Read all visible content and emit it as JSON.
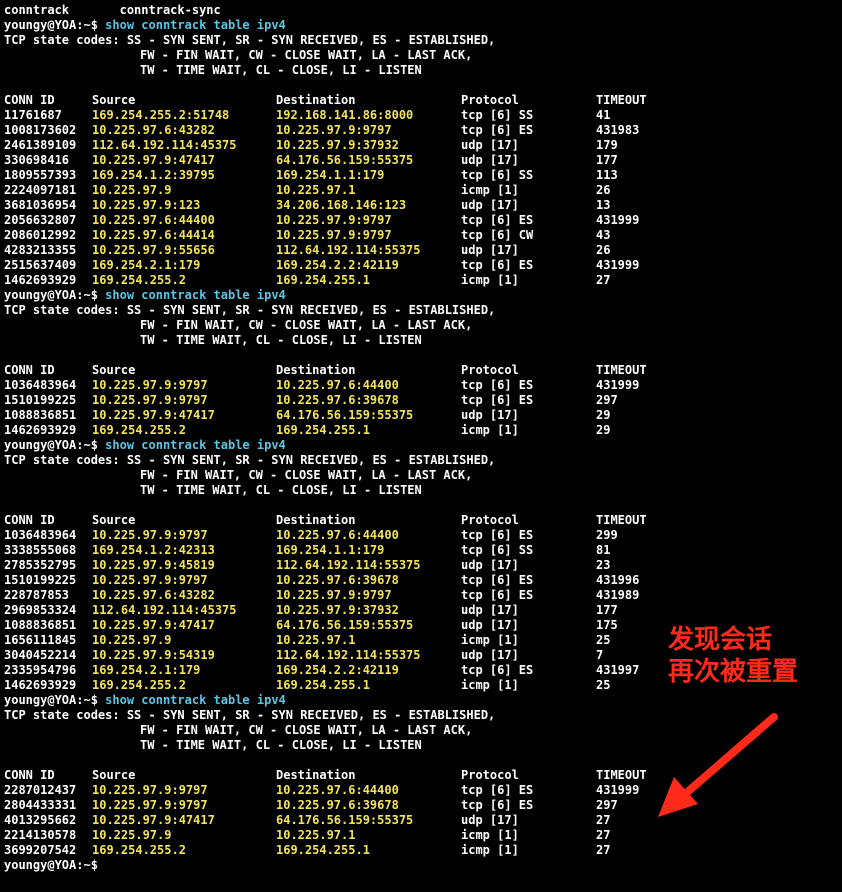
{
  "header_line": "conntrack       conntrack-sync",
  "prompt": "youngy@YOA:~$",
  "command": "show conntrack table ipv4",
  "legend": [
    "TCP state codes: SS - SYN SENT, SR - SYN RECEIVED, ES - ESTABLISHED,",
    "FW - FIN WAIT, CW - CLOSE WAIT, LA - LAST ACK,",
    "TW - TIME WAIT, CL - CLOSE, LI - LISTEN"
  ],
  "columns": [
    "CONN ID",
    "Source",
    "Destination",
    "Protocol",
    "TIMEOUT"
  ],
  "tables": [
    {
      "rows": [
        [
          "11761687",
          "169.254.255.2:51748",
          "192.168.141.86:8000",
          "tcp [6] SS",
          "41"
        ],
        [
          "1008173602",
          "10.225.97.6:43282",
          "10.225.97.9:9797",
          "tcp [6] ES",
          "431983"
        ],
        [
          "2461389109",
          "112.64.192.114:45375",
          "10.225.97.9:37932",
          "udp [17]",
          "179"
        ],
        [
          "330698416",
          "10.225.97.9:47417",
          "64.176.56.159:55375",
          "udp [17]",
          "177"
        ],
        [
          "1809557393",
          "169.254.1.2:39795",
          "169.254.1.1:179",
          "tcp [6] SS",
          "113"
        ],
        [
          "2224097181",
          "10.225.97.9",
          "10.225.97.1",
          "icmp [1]",
          "26"
        ],
        [
          "3681036954",
          "10.225.97.9:123",
          "34.206.168.146:123",
          "udp [17]",
          "13"
        ],
        [
          "2056632807",
          "10.225.97.6:44400",
          "10.225.97.9:9797",
          "tcp [6] ES",
          "431999"
        ],
        [
          "2086012992",
          "10.225.97.6:44414",
          "10.225.97.9:9797",
          "tcp [6] CW",
          "43"
        ],
        [
          "4283213355",
          "10.225.97.9:55656",
          "112.64.192.114:55375",
          "udp [17]",
          "26"
        ],
        [
          "2515637409",
          "169.254.2.1:179",
          "169.254.2.2:42119",
          "tcp [6] ES",
          "431999"
        ],
        [
          "1462693929",
          "169.254.255.2",
          "169.254.255.1",
          "icmp [1]",
          "27"
        ]
      ]
    },
    {
      "rows": [
        [
          "1036483964",
          "10.225.97.9:9797",
          "10.225.97.6:44400",
          "tcp [6] ES",
          "431999"
        ],
        [
          "1510199225",
          "10.225.97.9:9797",
          "10.225.97.6:39678",
          "tcp [6] ES",
          "297"
        ],
        [
          "1088836851",
          "10.225.97.9:47417",
          "64.176.56.159:55375",
          "udp [17]",
          "29"
        ],
        [
          "1462693929",
          "169.254.255.2",
          "169.254.255.1",
          "icmp [1]",
          "29"
        ]
      ]
    },
    {
      "rows": [
        [
          "1036483964",
          "10.225.97.9:9797",
          "10.225.97.6:44400",
          "tcp [6] ES",
          "299"
        ],
        [
          "3338555068",
          "169.254.1.2:42313",
          "169.254.1.1:179",
          "tcp [6] SS",
          "81"
        ],
        [
          "2785352795",
          "10.225.97.9:45819",
          "112.64.192.114:55375",
          "udp [17]",
          "23"
        ],
        [
          "1510199225",
          "10.225.97.9:9797",
          "10.225.97.6:39678",
          "tcp [6] ES",
          "431996"
        ],
        [
          "228787853",
          "10.225.97.6:43282",
          "10.225.97.9:9797",
          "tcp [6] ES",
          "431989"
        ],
        [
          "2969853324",
          "112.64.192.114:45375",
          "10.225.97.9:37932",
          "udp [17]",
          "177"
        ],
        [
          "1088836851",
          "10.225.97.9:47417",
          "64.176.56.159:55375",
          "udp [17]",
          "175"
        ],
        [
          "1656111845",
          "10.225.97.9",
          "10.225.97.1",
          "icmp [1]",
          "25"
        ],
        [
          "3040452214",
          "10.225.97.9:54319",
          "112.64.192.114:55375",
          "udp [17]",
          "7"
        ],
        [
          "2335954796",
          "169.254.2.1:179",
          "169.254.2.2:42119",
          "tcp [6] ES",
          "431997"
        ],
        [
          "1462693929",
          "169.254.255.2",
          "169.254.255.1",
          "icmp [1]",
          "25"
        ]
      ]
    },
    {
      "rows": [
        [
          "2287012437",
          "10.225.97.9:9797",
          "10.225.97.6:44400",
          "tcp [6] ES",
          "431999"
        ],
        [
          "2804433331",
          "10.225.97.9:9797",
          "10.225.97.6:39678",
          "tcp [6] ES",
          "297"
        ],
        [
          "4013295662",
          "10.225.97.9:47417",
          "64.176.56.159:55375",
          "udp [17]",
          "27"
        ],
        [
          "2214130578",
          "10.225.97.9",
          "10.225.97.1",
          "icmp [1]",
          "27"
        ],
        [
          "3699207542",
          "169.254.255.2",
          "169.254.255.1",
          "icmp [1]",
          "27"
        ]
      ]
    }
  ],
  "annotation": {
    "line1": "发现会话",
    "line2": "再次被重置",
    "color": "#ff2a1a"
  },
  "colors": {
    "background": "#000000",
    "text": "#ffffff",
    "address": "#f3e35a",
    "command": "#58c7e6"
  }
}
